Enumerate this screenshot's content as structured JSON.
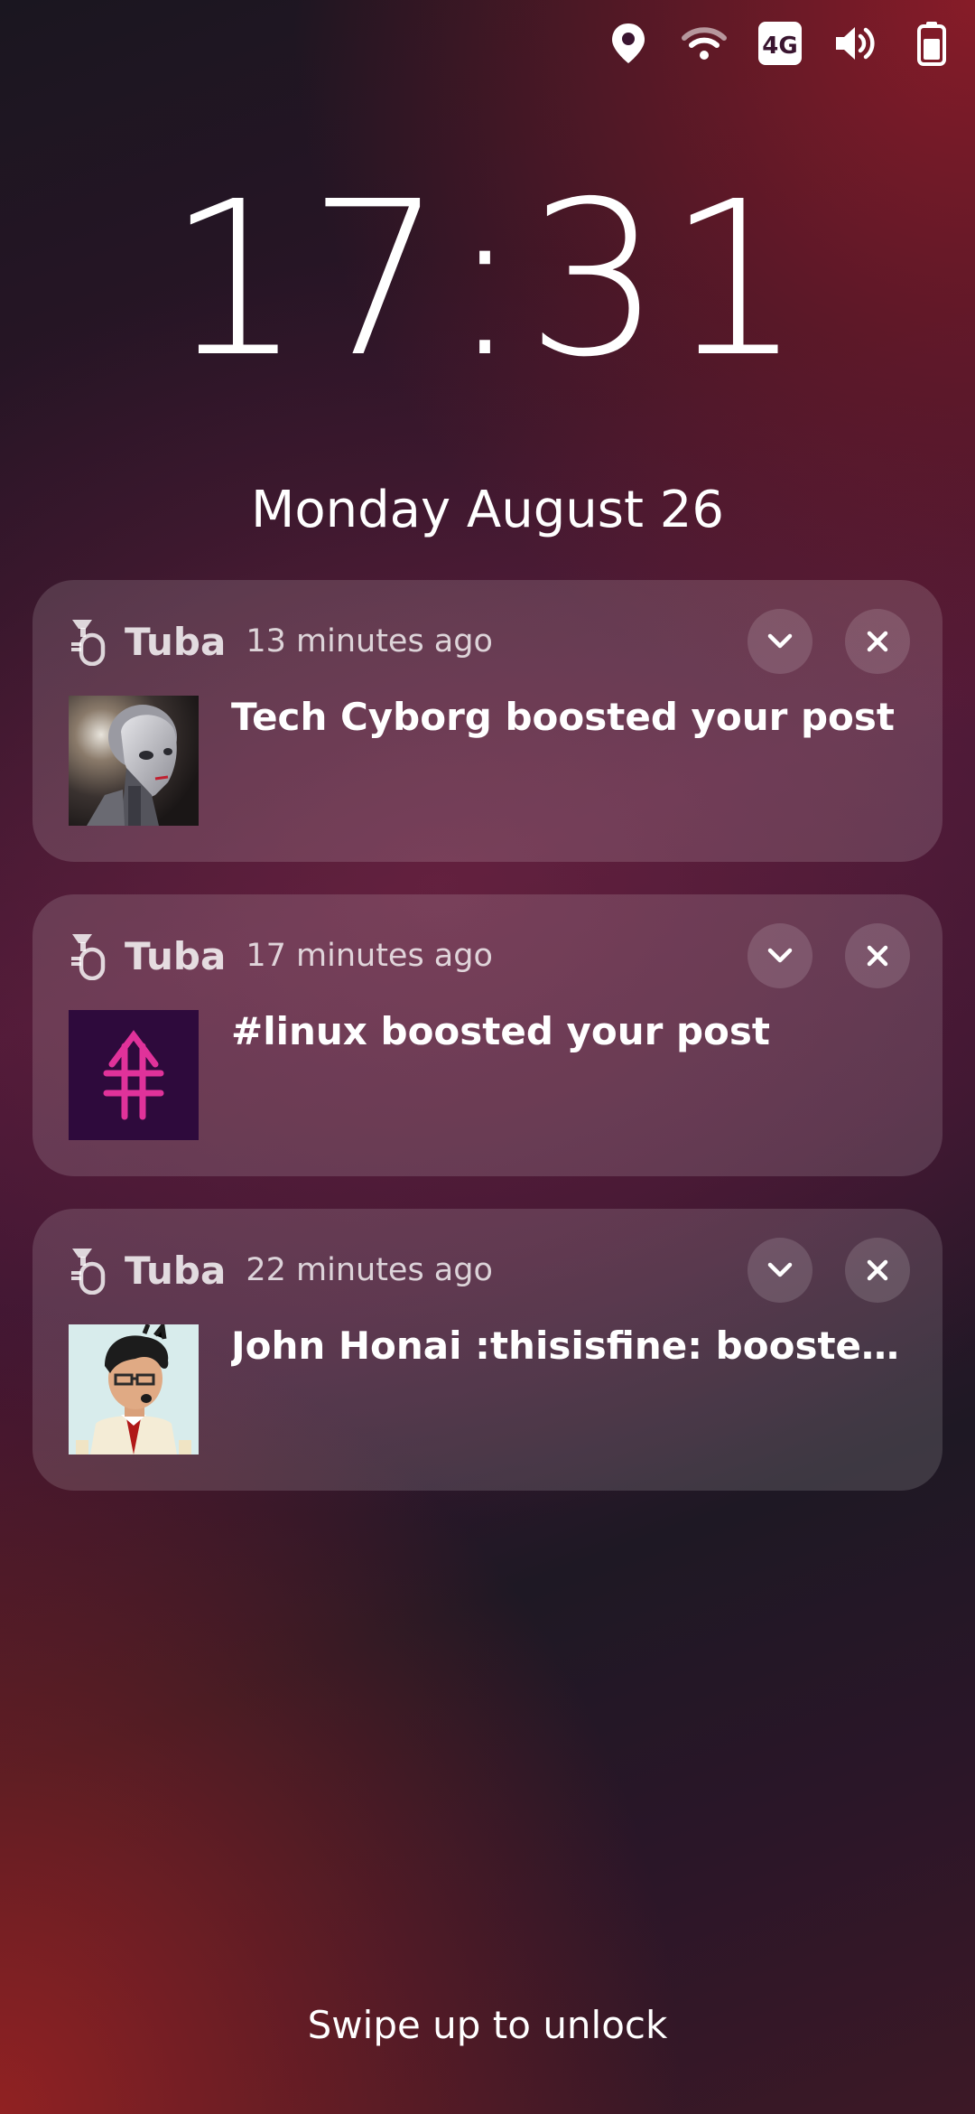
{
  "status_bar": {
    "icons": [
      "location-icon",
      "wifi-icon",
      "4g-icon",
      "volume-icon",
      "battery-icon"
    ],
    "network_label": "4G"
  },
  "clock": {
    "time": "17:31",
    "date": "Monday August 26"
  },
  "notifications": [
    {
      "app": "Tuba",
      "time_ago": "13 minutes ago",
      "text": "Tech Cyborg boosted your post",
      "avatar": "cyborg-avatar"
    },
    {
      "app": "Tuba",
      "time_ago": "17 minutes ago",
      "text": "#linux boosted your post",
      "avatar": "hashtag-avatar"
    },
    {
      "app": "Tuba",
      "time_ago": "22 minutes ago",
      "text": "John Honai :thisisfine: boosted you…",
      "avatar": "cartoon-man-avatar"
    }
  ],
  "unlock_hint": "Swipe up to unlock",
  "colors": {
    "hashtag_avatar_bg": "#2e0a3c",
    "hashtag_symbol": "#e0329a"
  }
}
